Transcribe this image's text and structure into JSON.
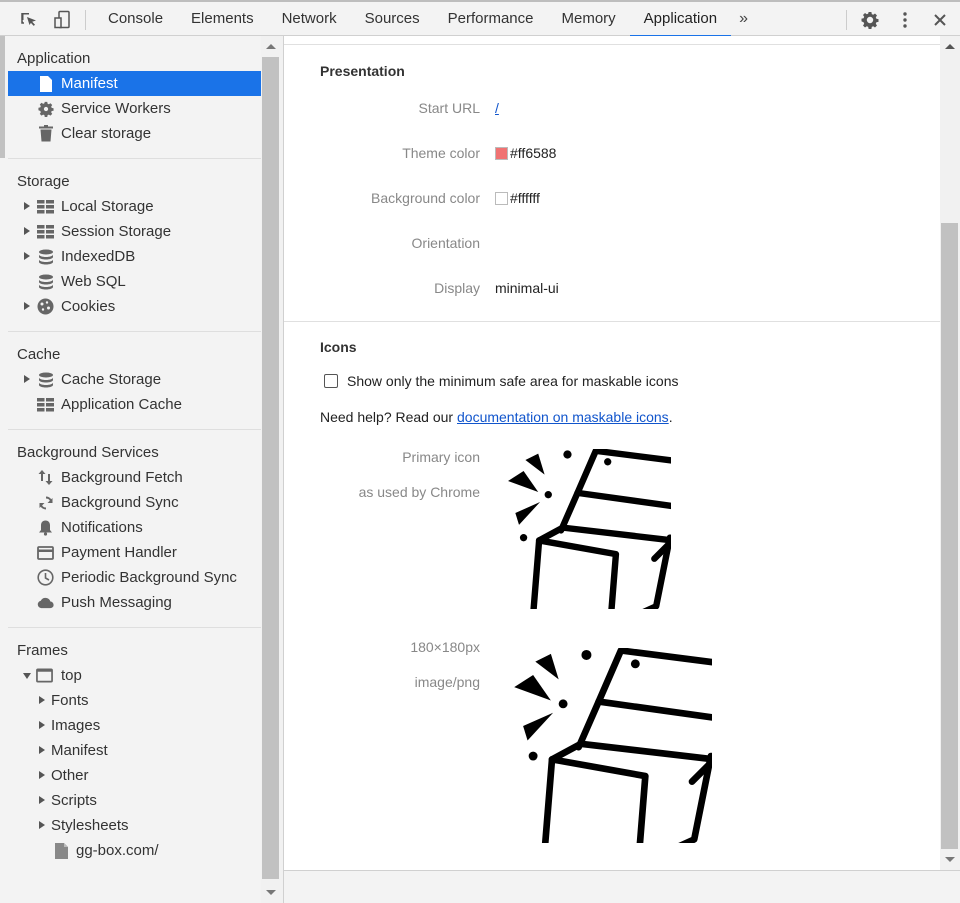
{
  "toolbar": {
    "inspect_icon": "inspect-element-icon",
    "device_icon": "device-toolbar-icon",
    "tabs": [
      {
        "label": "Console",
        "active": false
      },
      {
        "label": "Elements",
        "active": false
      },
      {
        "label": "Network",
        "active": false
      },
      {
        "label": "Sources",
        "active": false
      },
      {
        "label": "Performance",
        "active": false
      },
      {
        "label": "Memory",
        "active": false
      },
      {
        "label": "Application",
        "active": true
      }
    ],
    "more_tabs": "»",
    "settings_icon": "gear-icon",
    "menu_icon": "kebab-menu-icon",
    "close_icon": "close-icon",
    "accent_color": "#1a73e8"
  },
  "sidebar": {
    "sections": [
      {
        "title": "Application",
        "items": [
          {
            "label": "Manifest",
            "icon": "file-icon",
            "selected": true
          },
          {
            "label": "Service Workers",
            "icon": "gear-icon"
          },
          {
            "label": "Clear storage",
            "icon": "trash-icon"
          }
        ]
      },
      {
        "title": "Storage",
        "items": [
          {
            "label": "Local Storage",
            "icon": "grid-icon",
            "expandable": true
          },
          {
            "label": "Session Storage",
            "icon": "grid-icon",
            "expandable": true
          },
          {
            "label": "IndexedDB",
            "icon": "database-icon",
            "expandable": true
          },
          {
            "label": "Web SQL",
            "icon": "database-icon"
          },
          {
            "label": "Cookies",
            "icon": "cookie-icon",
            "expandable": true
          }
        ]
      },
      {
        "title": "Cache",
        "items": [
          {
            "label": "Cache Storage",
            "icon": "database-icon",
            "expandable": true
          },
          {
            "label": "Application Cache",
            "icon": "grid-icon"
          }
        ]
      },
      {
        "title": "Background Services",
        "items": [
          {
            "label": "Background Fetch",
            "icon": "up-down-arrows-icon"
          },
          {
            "label": "Background Sync",
            "icon": "sync-icon"
          },
          {
            "label": "Notifications",
            "icon": "bell-icon"
          },
          {
            "label": "Payment Handler",
            "icon": "credit-card-icon"
          },
          {
            "label": "Periodic Background Sync",
            "icon": "clock-icon"
          },
          {
            "label": "Push Messaging",
            "icon": "cloud-icon"
          }
        ]
      },
      {
        "title": "Frames",
        "items": [
          {
            "label": "top",
            "icon": "frame-icon",
            "expanded": true
          },
          {
            "label": "Fonts",
            "sub": true
          },
          {
            "label": "Images",
            "sub": true
          },
          {
            "label": "Manifest",
            "sub": true
          },
          {
            "label": "Other",
            "sub": true
          },
          {
            "label": "Scripts",
            "sub": true
          },
          {
            "label": "Stylesheets",
            "sub": true
          },
          {
            "label": "gg-box.com/",
            "icon": "file-icon",
            "leaf": true
          }
        ]
      }
    ]
  },
  "main": {
    "presentation": {
      "title": "Presentation",
      "start_url_label": "Start URL",
      "start_url_value": "/",
      "theme_color_label": "Theme color",
      "theme_color_value": "#ff6588",
      "theme_color_swatch": "#f07272",
      "background_color_label": "Background color",
      "background_color_value": "#ffffff",
      "background_color_swatch": "#ffffff",
      "orientation_label": "Orientation",
      "orientation_value": "",
      "display_label": "Display",
      "display_value": "minimal-ui"
    },
    "icons": {
      "title": "Icons",
      "checkbox_label": "Show only the minimum safe area for maskable icons",
      "checkbox_checked": false,
      "help_prefix": "Need help? Read our ",
      "help_link": "documentation on maskable icons",
      "help_suffix": ".",
      "primary_label": "Primary icon",
      "primary_sub": "as used by Chrome",
      "primary_image": "open-box-icon",
      "icon2_size": "180×180px",
      "icon2_type": "image/png",
      "icon2_image": "open-box-icon"
    }
  }
}
